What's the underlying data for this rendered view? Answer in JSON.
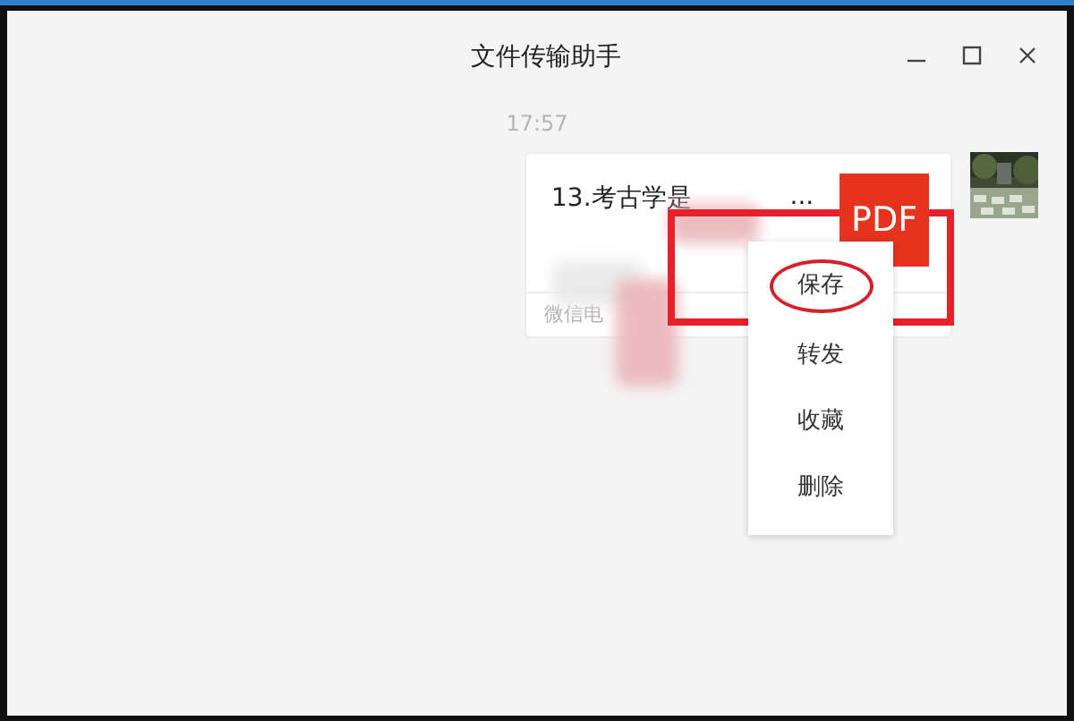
{
  "window": {
    "title": "文件传输助手"
  },
  "messages": [
    {
      "kind": "time",
      "text": "17:57"
    },
    {
      "kind": "file",
      "name_start": "13.考古学是",
      "name_end": "...",
      "file_type": "PDF",
      "source": "微信电"
    }
  ],
  "context_menu": {
    "items": [
      {
        "label": "保存",
        "circled": true
      },
      {
        "label": "转发",
        "circled": false
      },
      {
        "label": "收藏",
        "circled": false
      },
      {
        "label": "删除",
        "circled": false
      }
    ]
  },
  "annotation": {
    "boxed": true
  }
}
